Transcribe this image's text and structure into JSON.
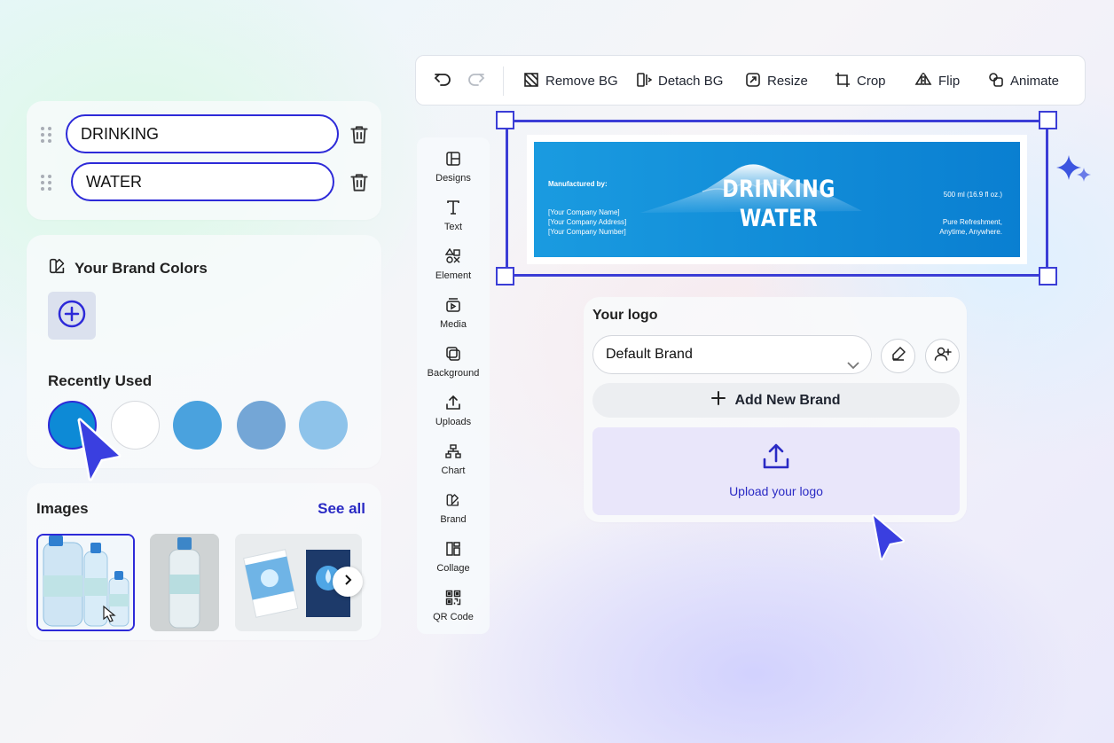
{
  "text_fields": [
    {
      "value": "DRINKING"
    },
    {
      "value": "WATER"
    }
  ],
  "brand_colors": {
    "title": "Your Brand Colors",
    "recently_used_title": "Recently Used",
    "swatches": [
      "#0d8ad6",
      "#ffffff",
      "#4aa2de",
      "#74a6d6",
      "#8ec3ea"
    ]
  },
  "images": {
    "title": "Images",
    "see_all": "See all"
  },
  "toolbar": {
    "remove_bg": "Remove BG",
    "detach_bg": "Detach BG",
    "resize": "Resize",
    "crop": "Crop",
    "flip": "Flip",
    "animate": "Animate"
  },
  "sidebar": {
    "items": [
      {
        "label": "Designs",
        "icon": "layout-icon"
      },
      {
        "label": "Text",
        "icon": "text-icon"
      },
      {
        "label": "Element",
        "icon": "shapes-icon"
      },
      {
        "label": "Media",
        "icon": "media-icon"
      },
      {
        "label": "Background",
        "icon": "background-icon"
      },
      {
        "label": "Uploads",
        "icon": "upload-icon"
      },
      {
        "label": "Chart",
        "icon": "chart-icon"
      },
      {
        "label": "Brand",
        "icon": "brand-icon"
      },
      {
        "label": "Collage",
        "icon": "collage-icon"
      },
      {
        "label": "QR Code",
        "icon": "qr-code-icon"
      }
    ]
  },
  "label_design": {
    "manufactured_by": "Manufactured by:",
    "company_name": "[Your Company Name]",
    "company_address": "[Your Company Address]",
    "company_number": "[Your Company Number]",
    "title_line1": "DRINKING",
    "title_line2": "WATER",
    "volume": "500 ml (16.9 fl oz.)",
    "tagline1": "Pure Refreshment,",
    "tagline2": "Anytime, Anywhere."
  },
  "logo_panel": {
    "title": "Your logo",
    "selected_brand": "Default Brand",
    "add_new_brand": "Add New Brand",
    "upload_label": "Upload your logo"
  },
  "colors": {
    "accent": "#2d2ad8",
    "selection": "#3b3dd6",
    "label_blue": "#0a7fd1"
  }
}
